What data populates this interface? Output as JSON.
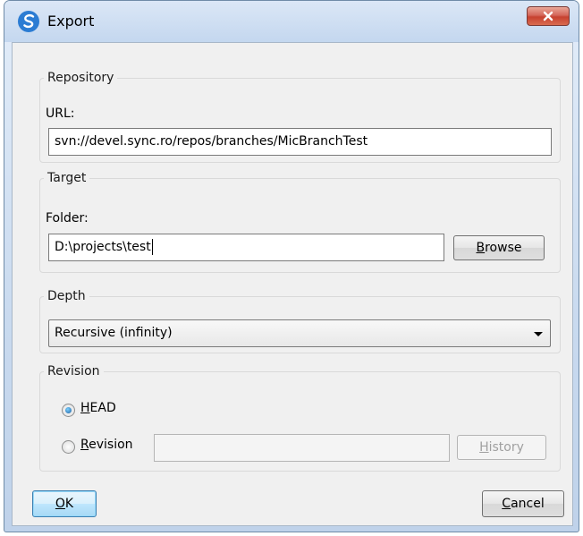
{
  "window": {
    "title": "Export",
    "close_glyph": "x"
  },
  "repository": {
    "legend": "Repository",
    "url_label": "URL:",
    "url_value": "svn://devel.sync.ro/repos/branches/MicBranchTest"
  },
  "target": {
    "legend": "Target",
    "folder_label": "Folder:",
    "folder_value": "D:\\projects\\test",
    "browse_first": "B",
    "browse_rest": "rowse"
  },
  "depth": {
    "legend": "Depth",
    "selected": "Recursive (infinity)"
  },
  "revision": {
    "legend": "Revision",
    "head_first": "H",
    "head_rest": "EAD",
    "rev_first": "R",
    "rev_rest": "evision",
    "revision_value": "",
    "history_first": "H",
    "history_rest": "istory",
    "head_selected": true
  },
  "footer": {
    "ok_first": "O",
    "ok_rest": "K",
    "cancel_first": "C",
    "cancel_rest": "ancel"
  },
  "colors": {
    "accent": "#1f5fa0",
    "close_red": "#c7412f"
  },
  "icons": [
    "app-logo-icon",
    "close-icon",
    "chevron-down-icon",
    "radio-selected-icon",
    "radio-unselected-icon"
  ]
}
